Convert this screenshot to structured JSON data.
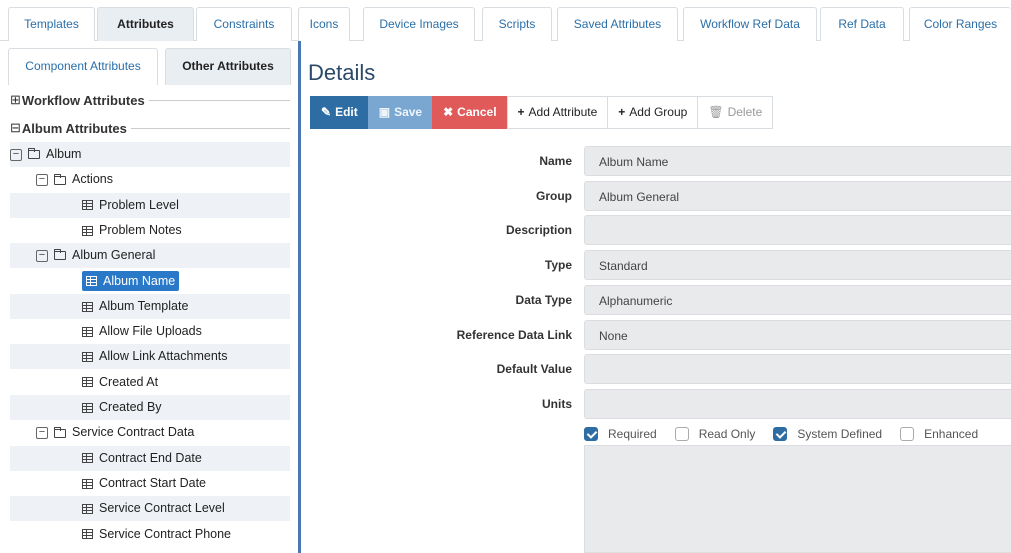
{
  "top_tabs": [
    {
      "label": "Templates",
      "active": false
    },
    {
      "label": "Attributes",
      "active": true
    },
    {
      "label": "Constraints",
      "active": false
    },
    {
      "label": "Icons",
      "active": false
    },
    {
      "label": "Device Images",
      "active": false
    },
    {
      "label": "Scripts",
      "active": false
    },
    {
      "label": "Saved Attributes",
      "active": false
    },
    {
      "label": "Workflow Ref Data",
      "active": false
    },
    {
      "label": "Ref Data",
      "active": false
    },
    {
      "label": "Color Ranges",
      "active": false
    }
  ],
  "sub_tabs": [
    {
      "label": "Component Attributes",
      "active": false
    },
    {
      "label": "Other Attributes",
      "active": true
    }
  ],
  "sections": {
    "workflow": "Workflow Attributes",
    "album": "Album Attributes",
    "collapsed_glyph": "⊞",
    "expanded_glyph": "⊟"
  },
  "tree": [
    {
      "label": "Album",
      "kind": "folder",
      "level": 0
    },
    {
      "label": "Actions",
      "kind": "folder",
      "level": 1
    },
    {
      "label": "Problem Level",
      "kind": "item",
      "level": 2
    },
    {
      "label": "Problem Notes",
      "kind": "item",
      "level": 2
    },
    {
      "label": "Album General",
      "kind": "folder",
      "level": 1
    },
    {
      "label": "Album Name",
      "kind": "item",
      "level": 2,
      "selected": true
    },
    {
      "label": "Album Template",
      "kind": "item",
      "level": 2
    },
    {
      "label": "Allow File Uploads",
      "kind": "item",
      "level": 2
    },
    {
      "label": "Allow Link Attachments",
      "kind": "item",
      "level": 2
    },
    {
      "label": "Created At",
      "kind": "item",
      "level": 2
    },
    {
      "label": "Created By",
      "kind": "item",
      "level": 2
    },
    {
      "label": "Service Contract Data",
      "kind": "folder",
      "level": 1
    },
    {
      "label": "Contract End Date",
      "kind": "item",
      "level": 2
    },
    {
      "label": "Contract Start Date",
      "kind": "item",
      "level": 2
    },
    {
      "label": "Service Contract Level",
      "kind": "item",
      "level": 2
    },
    {
      "label": "Service Contract Phone",
      "kind": "item",
      "level": 2
    }
  ],
  "details": {
    "title": "Details",
    "toolbar": {
      "edit": "Edit",
      "save": "Save",
      "cancel": "Cancel",
      "add_attribute": "Add Attribute",
      "add_group": "Add Group",
      "delete": "Delete"
    },
    "fields": [
      {
        "label": "Name",
        "value": "Album Name"
      },
      {
        "label": "Group",
        "value": "Album General"
      },
      {
        "label": "Description",
        "value": ""
      },
      {
        "label": "Type",
        "value": "Standard"
      },
      {
        "label": "Data Type",
        "value": "Alphanumeric"
      },
      {
        "label": "Reference Data Link",
        "value": "None"
      },
      {
        "label": "Default Value",
        "value": ""
      },
      {
        "label": "Units",
        "value": ""
      }
    ],
    "checkboxes": [
      {
        "label": "Required",
        "checked": true
      },
      {
        "label": "Read Only",
        "checked": false
      },
      {
        "label": "System Defined",
        "checked": true
      },
      {
        "label": "Enhanced",
        "checked": false
      }
    ]
  },
  "colors": {
    "accent": "#2e6da4",
    "selected": "#2a78c8",
    "cancel": "#e05a5a",
    "divider": "#4a78b4"
  }
}
